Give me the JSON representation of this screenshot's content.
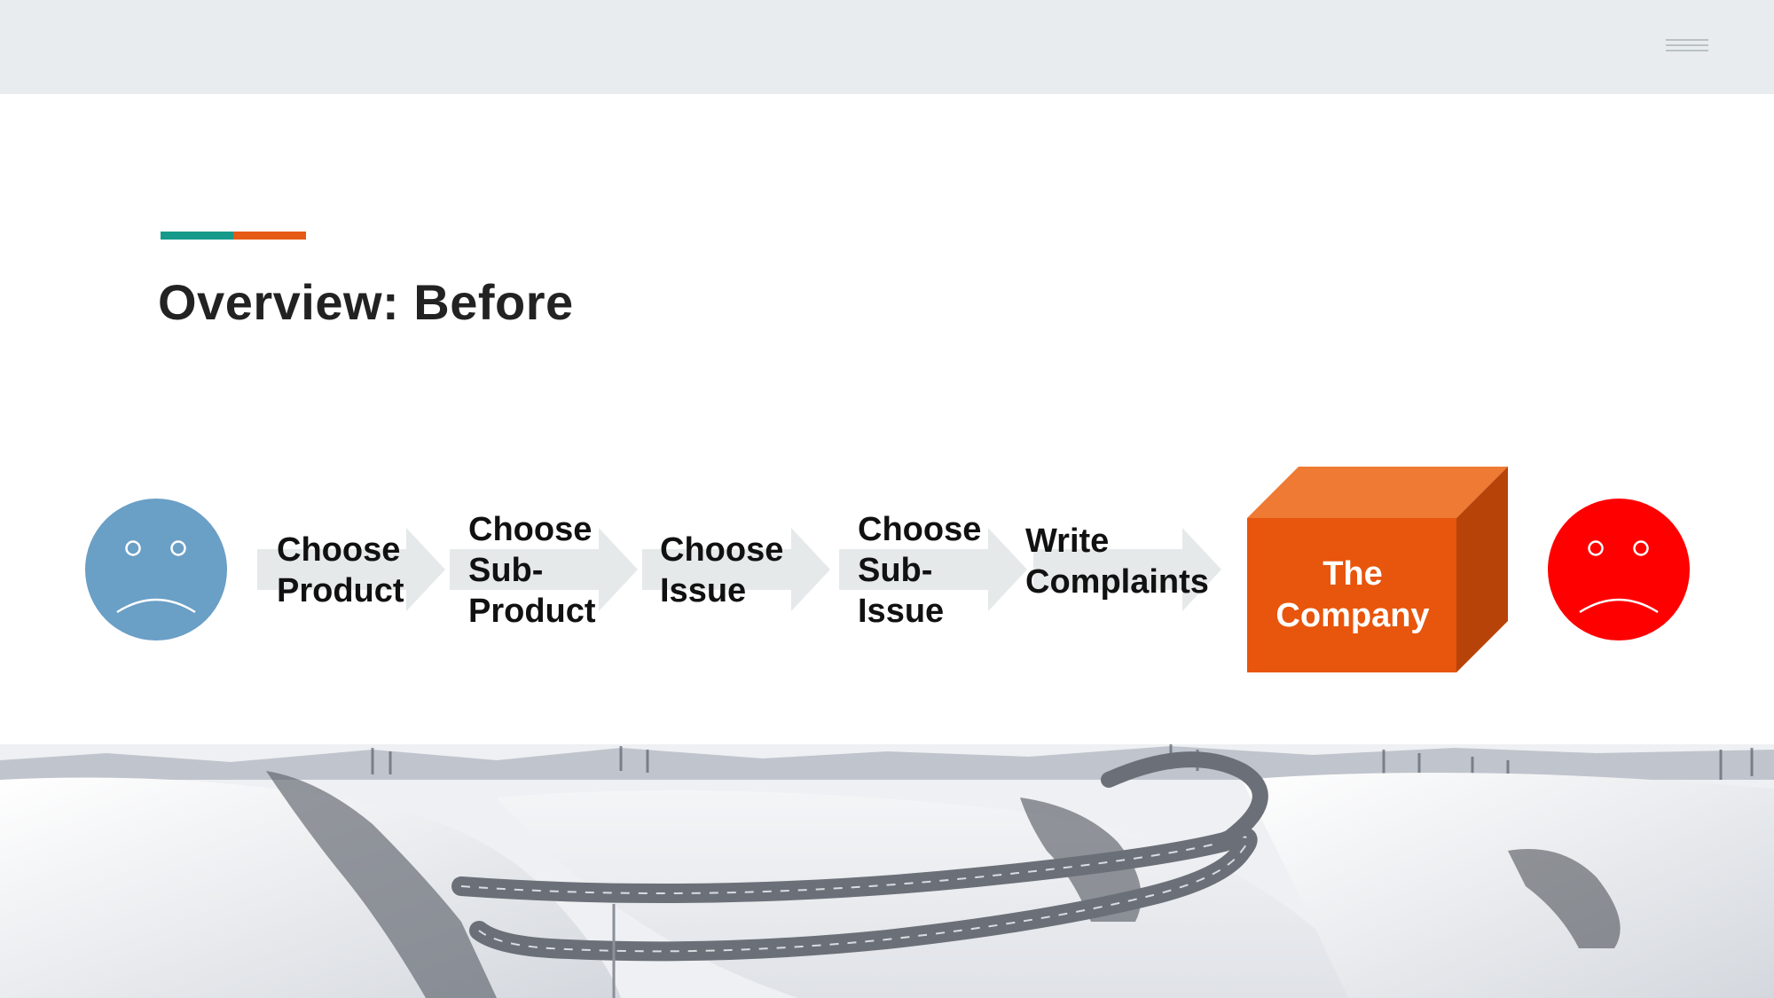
{
  "header": {
    "menu_icon": "hamburger-menu-icon"
  },
  "slide": {
    "title": "Overview: Before",
    "accent_colors": {
      "left": "#169a8a",
      "right": "#e55a14"
    }
  },
  "flow": {
    "start_face": {
      "icon": "sad-face-icon",
      "color": "#6a9fc6"
    },
    "steps": [
      {
        "label": "Choose\nProduct"
      },
      {
        "label": "Choose\nSub-\nProduct"
      },
      {
        "label": "Choose\nIssue"
      },
      {
        "label": "Choose\nSub-\nIssue"
      },
      {
        "label": "Write\nComplaints"
      }
    ],
    "arrow_color": "#e6e9ea",
    "target": {
      "label": "The\nCompany",
      "color": "#e8550c"
    },
    "end_face": {
      "icon": "sad-face-icon",
      "color": "#ff0000"
    }
  },
  "background_image": {
    "icon": "snowy-mountain-road-image"
  }
}
